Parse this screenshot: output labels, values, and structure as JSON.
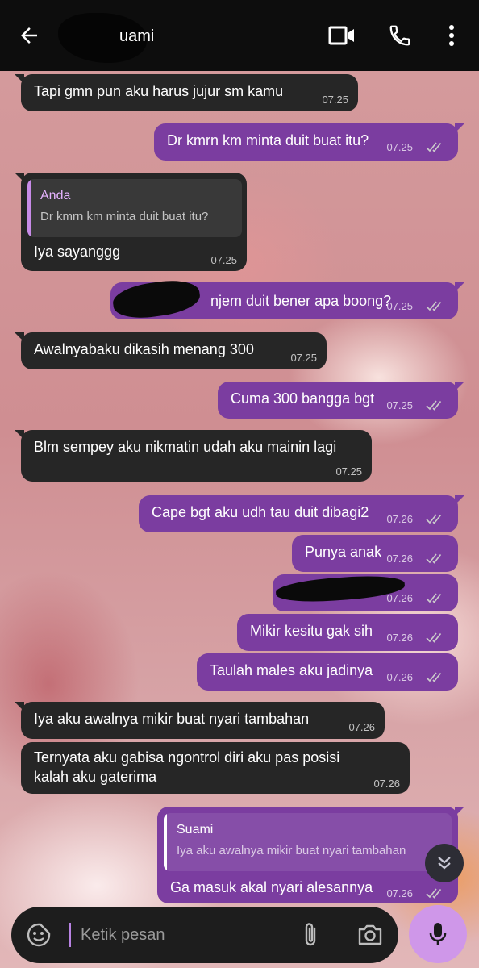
{
  "header": {
    "contact_name": "uami"
  },
  "colors": {
    "outgoing_bubble": "#7b3da0",
    "incoming_bubble": "#262626",
    "header_bg": "#0d0d0d",
    "mic_button": "#cf97e9",
    "quote_name_out": "#ffffff",
    "quote_name_in": "#e6b3ff"
  },
  "icons": {
    "back": "arrow-left-icon",
    "video": "video-camera-icon",
    "call": "phone-icon",
    "more": "more-vertical-icon",
    "emoji": "sticker-icon",
    "attach": "paperclip-icon",
    "camera": "camera-icon",
    "mic": "microphone-icon",
    "scroll_down": "double-chevron-down-icon",
    "read": "double-check-icon"
  },
  "messages": [
    {
      "direction": "in",
      "text": "Tapi gmn pun aku harus jujur sm kamu",
      "time": "07.25"
    },
    {
      "direction": "out",
      "text": "Dr kmrn km minta duit buat itu?",
      "time": "07.25"
    },
    {
      "direction": "in",
      "quote_name": "Anda",
      "quote_text": "Dr kmrn km minta duit buat itu?",
      "text": "Iya sayanggg",
      "time": "07.25"
    },
    {
      "direction": "out",
      "text": "njem duit bener apa boong?",
      "time": "07.25"
    },
    {
      "direction": "in",
      "text": "Awalnyabaku dikasih menang 300",
      "time": "07.25"
    },
    {
      "direction": "out",
      "text": "Cuma 300 bangga bgt",
      "time": "07.25"
    },
    {
      "direction": "in",
      "text": "Blm sempey aku nikmatin udah aku mainin lagi",
      "time": "07.25"
    },
    {
      "direction": "out",
      "text": "Cape bgt aku udh tau duit dibagi2",
      "time": "07.26"
    },
    {
      "direction": "out",
      "text": "Punya anak",
      "time": "07.26"
    },
    {
      "direction": "out",
      "text": "",
      "time": "07.26"
    },
    {
      "direction": "out",
      "text": "Mikir kesitu gak sih",
      "time": "07.26"
    },
    {
      "direction": "out",
      "text": "Taulah males aku jadinya",
      "time": "07.26"
    },
    {
      "direction": "in",
      "text": "Iya aku awalnya mikir buat nyari tambahan",
      "time": "07.26"
    },
    {
      "direction": "in",
      "text_line1": "Ternyata aku gabisa ngontrol diri aku pas posisi",
      "text_line2": "kalah aku gaterima",
      "time": "07.26"
    },
    {
      "direction": "out",
      "quote_name": "Suami",
      "quote_text": "Iya aku awalnya mikir buat nyari tambahan",
      "text": "Ga masuk akal nyari alesannya",
      "time": "07.26"
    }
  ],
  "composer": {
    "placeholder": "Ketik pesan"
  }
}
